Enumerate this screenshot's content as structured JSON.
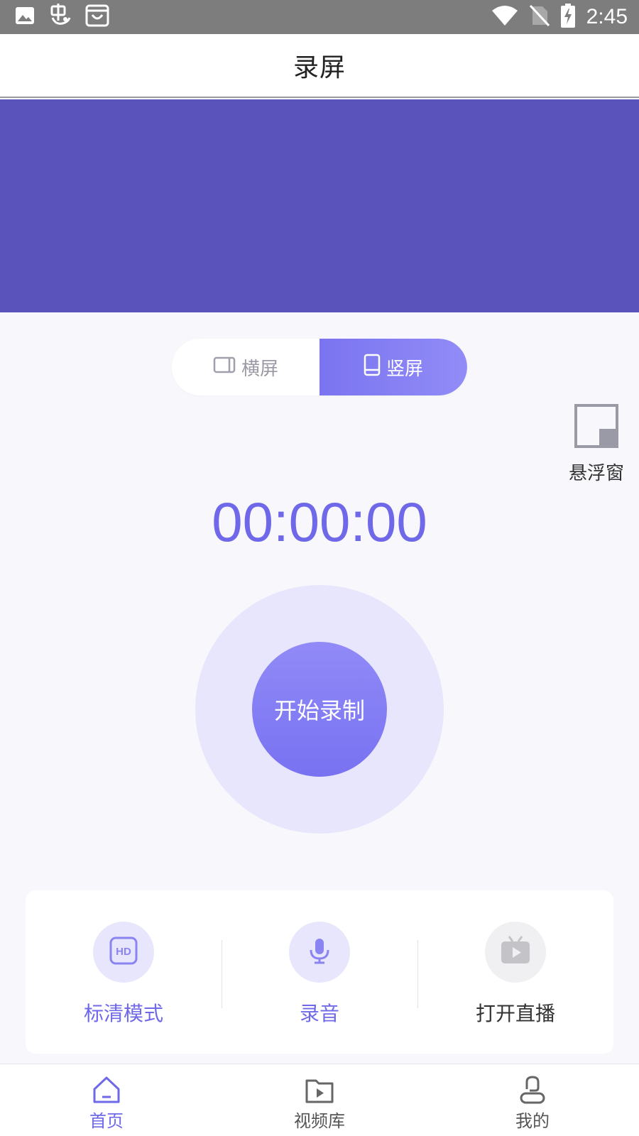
{
  "status_bar": {
    "time": "2:45",
    "left_icons": [
      "image-icon",
      "bug-icon",
      "bag-icon"
    ],
    "right_icons": [
      "wifi-icon",
      "no-sim-icon",
      "battery-charging-icon"
    ]
  },
  "header": {
    "title": "录屏"
  },
  "banner": {
    "color": "#5a53bb"
  },
  "orientation": {
    "landscape_label": "横屏",
    "portrait_label": "竖屏",
    "selected": "portrait"
  },
  "floating_window": {
    "label": "悬浮窗"
  },
  "timer": {
    "value": "00:00:00"
  },
  "record": {
    "label": "开始录制"
  },
  "options": [
    {
      "id": "hd",
      "label": "标清模式",
      "icon": "hd-icon"
    },
    {
      "id": "audio",
      "label": "录音",
      "icon": "microphone-icon"
    },
    {
      "id": "live",
      "label": "打开直播",
      "icon": "tv-play-icon"
    }
  ],
  "bottom_nav": [
    {
      "id": "home",
      "label": "首页",
      "icon": "home-icon",
      "active": true
    },
    {
      "id": "library",
      "label": "视频库",
      "icon": "video-folder-icon",
      "active": false
    },
    {
      "id": "mine",
      "label": "我的",
      "icon": "user-icon",
      "active": false
    }
  ],
  "colors": {
    "accent": "#6f68e8",
    "accent_light": "#e8e6fc",
    "status_bar": "#7d7d7d",
    "inactive_text": "#555555"
  }
}
